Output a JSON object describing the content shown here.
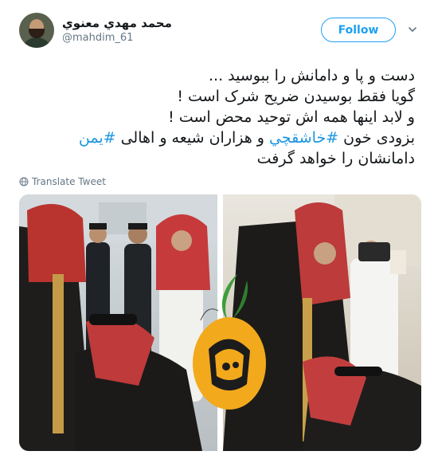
{
  "user": {
    "display_name": "محمد مهدي معنوي",
    "handle": "@mahdim_61"
  },
  "follow_label": "Follow",
  "tweet": {
    "line1": "دست و پا و دامانش را ببوسید ...",
    "line2": "گویا فقط بوسیدن ضریح شرک است !",
    "line3": "و لابد اینها همه اش توحید محض است !",
    "line4_before": "بزودی خون ",
    "hashtag1": "#خاشقچي",
    "line4_middle": " و هزاران شیعه و اهالی ",
    "hashtag2": "#یمن",
    "line5": "دامانشان را خواهد گرفت"
  },
  "translate_label": "Translate Tweet",
  "colors": {
    "accent": "#1da1f2",
    "hashtag": "#1b95e0",
    "secondary_text": "#657786"
  },
  "icons": [
    "avatar",
    "chevron-down-icon",
    "globe-icon",
    "watermark-logo"
  ]
}
